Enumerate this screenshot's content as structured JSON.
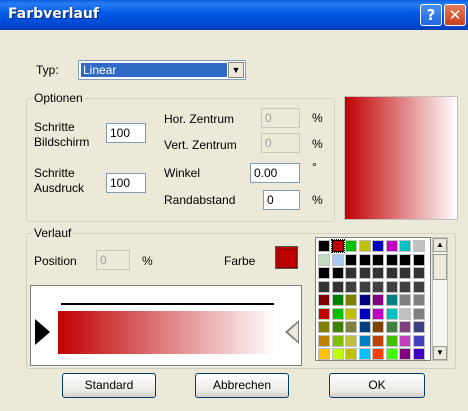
{
  "window": {
    "title": "Farbverlauf",
    "help_glyph": "?",
    "close_glyph": "✕"
  },
  "typ": {
    "label": "Typ:",
    "value": "Linear",
    "arrow_glyph": "▼"
  },
  "optionen": {
    "legend": "Optionen",
    "schritte_bildschirm_label": "Schritte\nBildschirm",
    "schritte_bildschirm_value": "100",
    "schritte_ausdruck_label": "Schritte\nAusdruck",
    "schritte_ausdruck_value": "100",
    "hor_zentrum_label": "Hor. Zentrum",
    "hor_zentrum_value": "0",
    "hor_zentrum_unit": "%",
    "vert_zentrum_label": "Vert. Zentrum",
    "vert_zentrum_value": "0",
    "vert_zentrum_unit": "%",
    "winkel_label": "Winkel",
    "winkel_value": "0.00",
    "winkel_unit": "°",
    "randabstand_label": "Randabstand",
    "randabstand_value": "0",
    "randabstand_unit": "%"
  },
  "verlauf": {
    "legend": "Verlauf",
    "position_label": "Position",
    "position_value": "0",
    "position_unit": "%",
    "farbe_label": "Farbe",
    "selected_color": "#c00000"
  },
  "palette": {
    "columns": 8,
    "selected_index": 1,
    "colors": [
      "#000000",
      "#c00000",
      "#00c000",
      "#c0c000",
      "#0000c0",
      "#c000c0",
      "#00c0c0",
      "#c0c0c0",
      "#c0dcc0",
      "#a6caf0",
      "#000000",
      "#000000",
      "#000000",
      "#000000",
      "#000000",
      "#000000",
      "#000000",
      "#000000",
      "#333333",
      "#333333",
      "#333333",
      "#333333",
      "#333333",
      "#333333",
      "#333333",
      "#333333",
      "#404040",
      "#404040",
      "#404040",
      "#404040",
      "#404040",
      "#404040",
      "#800000",
      "#008000",
      "#808000",
      "#000080",
      "#800080",
      "#008080",
      "#808080",
      "#808080",
      "#c00000",
      "#00c000",
      "#c0c000",
      "#0000c0",
      "#c000c0",
      "#00c0c0",
      "#c0c0c0",
      "#808080",
      "#808000",
      "#408000",
      "#808040",
      "#004080",
      "#804000",
      "#408040",
      "#804080",
      "#404080",
      "#c08000",
      "#80c000",
      "#c0c040",
      "#0080c0",
      "#c04000",
      "#40c000",
      "#c040c0",
      "#4040c0",
      "#ffc000",
      "#c0ff00",
      "#c0c000",
      "#00c0ff",
      "#ff4000",
      "#40ff00",
      "#800080",
      "#4000c0"
    ]
  },
  "buttons": {
    "standard": "Standard",
    "abbrechen": "Abbrechen",
    "ok": "OK"
  },
  "scroll": {
    "up_glyph": "▲",
    "down_glyph": "▼"
  },
  "colors": {
    "gradient_start": "#c00000",
    "gradient_end": "#ffffff",
    "titlebar": "#0058e6"
  }
}
